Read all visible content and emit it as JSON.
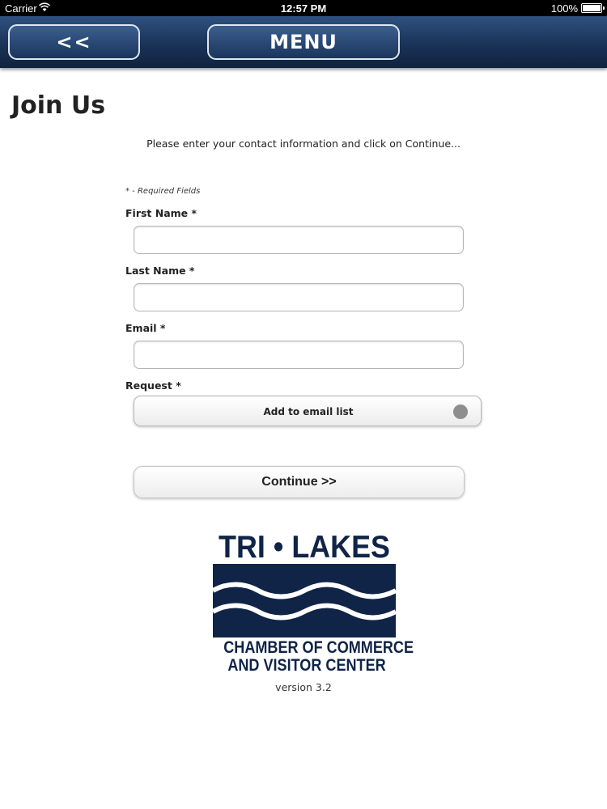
{
  "status_bar": {
    "carrier": "Carrier",
    "time": "12:57 PM",
    "battery": "100%"
  },
  "nav": {
    "back_label": "<<",
    "menu_label": "MENU"
  },
  "page": {
    "title": "Join Us",
    "instructions": "Please enter your contact information and click on Continue..."
  },
  "form": {
    "required_note": "* - Required Fields",
    "first_name": {
      "label": "First Name *",
      "value": ""
    },
    "last_name": {
      "label": "Last Name *",
      "value": ""
    },
    "email": {
      "label": "Email *",
      "value": ""
    },
    "request": {
      "label": "Request *",
      "selected": "Add to email list"
    },
    "continue_label": "Continue >>"
  },
  "logo": {
    "top_text": "TRI • LAKES",
    "line1": "CHAMBER OF COMMERCE",
    "line2": "AND VISITOR CENTER",
    "color": "#0f2447"
  },
  "footer": {
    "version": "version 3.2"
  },
  "colors": {
    "nav_bar": "#1a3358",
    "radio_dot": "#8e8e8e"
  }
}
